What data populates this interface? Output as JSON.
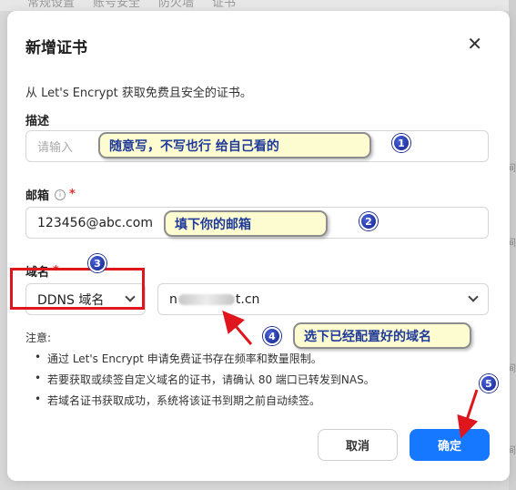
{
  "background": {
    "tabs": [
      "常规设置",
      "账号安全",
      "防火墙",
      "证书"
    ],
    "right_edge": [
      "间",
      "间",
      "间",
      "间"
    ]
  },
  "dialog": {
    "title": "新增证书",
    "close_glyph": "✕",
    "subtitle": "从 Let's Encrypt 获取免费且安全的证书。"
  },
  "form": {
    "description": {
      "label": "描述",
      "placeholder": "请输入",
      "value": ""
    },
    "email": {
      "label": "邮箱",
      "info_glyph": "i",
      "required_mark": "*",
      "value": "123456@abc.com"
    },
    "domain": {
      "label": "域名",
      "required_mark": "*",
      "type_selected": "DDNS 域名",
      "domain_prefix": "n",
      "domain_suffix": "t.cn"
    }
  },
  "notes": {
    "title": "注意:",
    "items": [
      "通过 Let's Encrypt 申请免费证书存在频率和数量限制。",
      "若要获取或续签自定义域名的证书，请确认 80 端口已转发到NAS。",
      "若域名证书获取成功，系统将该证书到期之前自动续签。"
    ]
  },
  "buttons": {
    "cancel": "取消",
    "confirm": "确定"
  },
  "annotations": {
    "callout_description": "随意写，不写也行 给自己看的",
    "callout_email": "填下你的邮箱",
    "callout_domain": "选下已经配置好的域名",
    "badges": [
      "1",
      "2",
      "3",
      "4",
      "5"
    ]
  },
  "colors": {
    "primary_button": "#1677ff",
    "required_mark": "#e0322b",
    "highlight_box": "#e0161e",
    "callout_fill": "#fdfbd0",
    "callout_text": "#1f3a9a",
    "badge": "#13228c"
  }
}
